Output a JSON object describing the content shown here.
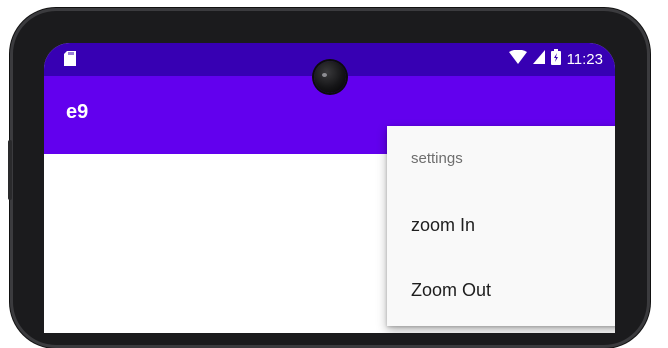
{
  "status_bar": {
    "time": "11:23",
    "icons": [
      "sd-card-icon",
      "wifi-icon",
      "signal-icon",
      "battery-icon"
    ]
  },
  "app_bar": {
    "title": "e9"
  },
  "overflow_menu": {
    "items": [
      {
        "label": "settings"
      },
      {
        "label": "zoom In"
      },
      {
        "label": "Zoom Out"
      }
    ]
  },
  "colors": {
    "status_bar": "#3700b3",
    "app_bar": "#6200ee",
    "menu_background": "#f9f9f9"
  }
}
